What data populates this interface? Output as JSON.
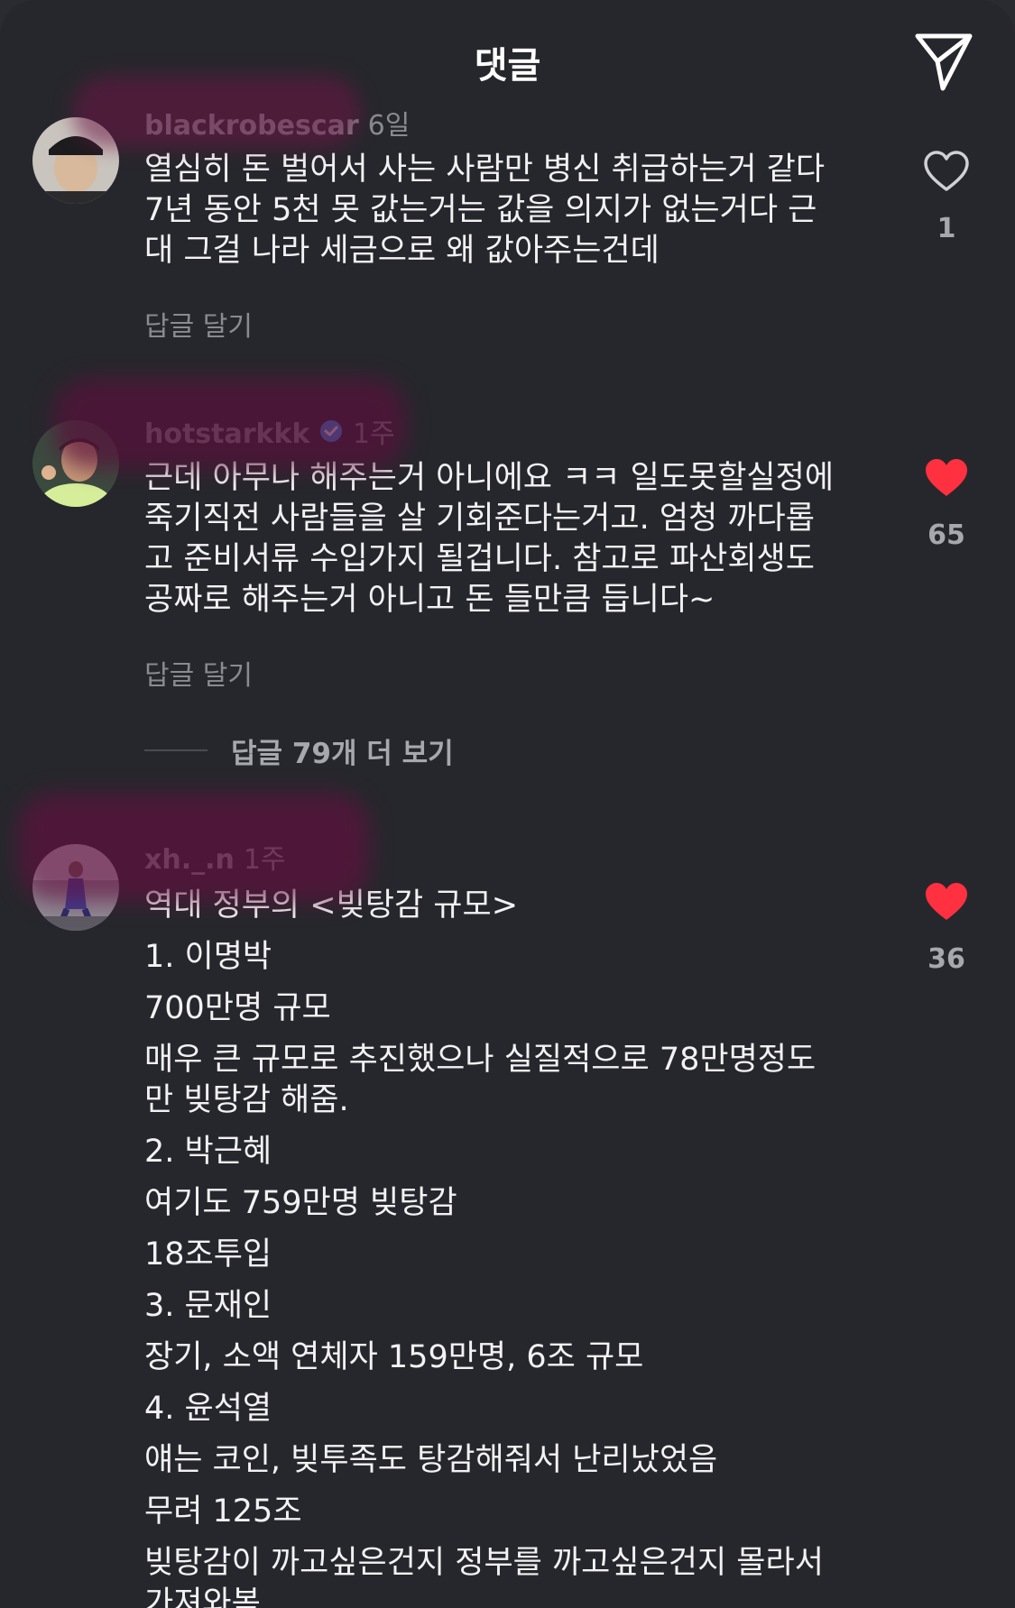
{
  "header": {
    "title": "댓글",
    "share_icon": "send-icon"
  },
  "comments": [
    {
      "username": "blackrobescar",
      "time": "6일",
      "text": "열심히 돈 벌어서 사는 사람만 병신 취급하는거 같다\n7년 동안 5천 못 값는거는 값을 의지가 없는거다 근\n대 그걸 나라 세금으로 왜 값아주는건데",
      "reply_label": "답글 달기",
      "likes": "1",
      "liked": false
    },
    {
      "username": "hotstarkkk",
      "verified": true,
      "time": "1주",
      "text": "근데 아무나 해주는거 아니에요 ㅋㅋ 일도못할실정에\n죽기직전 사람들을 살 기회준다는거고. 엄청 까다롭\n고 준비서류 수입가지 될겁니다. 참고로 파산회생도\n공짜로 해주는거 아니고 돈 들만큼 듭니다~",
      "reply_label": "답글 달기",
      "likes": "65",
      "liked": true,
      "more_replies": "답글 79개 더 보기"
    },
    {
      "username": "xh._.n",
      "time": "1주",
      "lines": [
        "역대 정부의 <빚탕감 규모>",
        "1. 이명박",
        "700만명 규모",
        "매우 큰 규모로 추진했으나 실질적으로 78만명정도\n만 빚탕감 해줌.",
        "2. 박근혜",
        "여기도 759만명 빚탕감",
        "18조투입",
        "3. 문재인",
        "장기, 소액 연체자 159만명, 6조 규모",
        "4. 윤석열",
        "얘는 코인, 빚투족도 탕감해줘서 난리났었음",
        "무려 125조",
        "빚탕감이 까고싶은건지 정부를 까고싶은건지 몰라서\n가져와봄"
      ],
      "likes": "36",
      "liked": true
    }
  ],
  "colors": {
    "background": "#26272c",
    "text": "#f2f2f4",
    "muted": "#8a8b90",
    "heart_liked": "#ff3040"
  }
}
